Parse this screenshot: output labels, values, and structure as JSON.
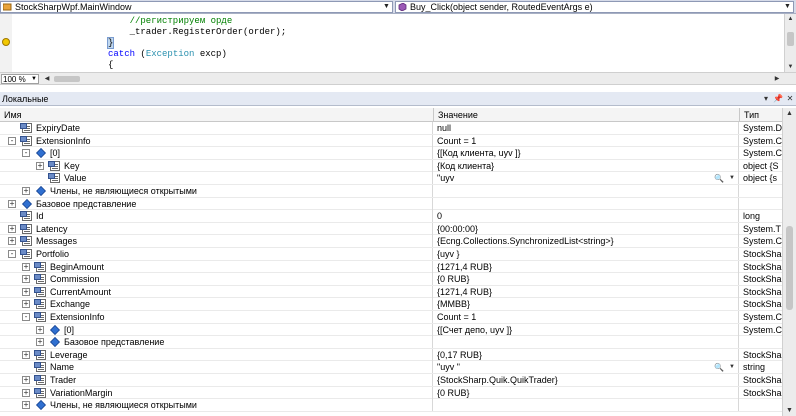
{
  "navbar": {
    "class_combo": "StockSharpWpf.MainWindow",
    "member_combo": "Buy_Click(object sender, RoutedEventArgs e)"
  },
  "editor": {
    "lines": [
      {
        "text": "    //регистрируем орде",
        "kind": "comment"
      },
      {
        "text": "    _trader.RegisterOrder(order);",
        "kind": "code"
      },
      {
        "text": "}",
        "kind": "brace"
      },
      {
        "text_kw": "catch",
        "text_open": " (",
        "text_type": "Exception",
        "text_rest": " excp)",
        "kind": "catch"
      },
      {
        "text": "{",
        "kind": "code"
      }
    ]
  },
  "zoom": {
    "value": "100 %"
  },
  "locals": {
    "title": "Локальные",
    "pin_icon": "pin-icon",
    "close_icon": "close-icon",
    "columns": {
      "name": "Имя",
      "value": "Значение",
      "type": "Тип"
    },
    "rows": [
      {
        "indent": 1,
        "expander": "",
        "icon": "prop",
        "name": "ExpiryDate",
        "value": "null",
        "type": "System.D"
      },
      {
        "indent": 1,
        "expander": "-",
        "icon": "prop",
        "name": "ExtensionInfo",
        "value": "Count = 1",
        "type": "System.C"
      },
      {
        "indent": 2,
        "expander": "-",
        "icon": "diamond",
        "name": "[0]",
        "value": "{[Код клиента, uyv        ]}",
        "type": "System.C"
      },
      {
        "indent": 3,
        "expander": "+",
        "icon": "prop",
        "name": "Key",
        "value": "{Код клиента}",
        "type": "object {S"
      },
      {
        "indent": 3,
        "expander": "",
        "icon": "prop",
        "name": "Value",
        "value": "\"uyv",
        "type": "object {s",
        "search": true
      },
      {
        "indent": 2,
        "expander": "+",
        "icon": "diamond",
        "name": "Члены, не являющиеся открытыми",
        "value": "",
        "type": ""
      },
      {
        "indent": 1,
        "expander": "+",
        "icon": "diamond",
        "name": "Базовое представление",
        "value": "",
        "type": ""
      },
      {
        "indent": 1,
        "expander": "",
        "icon": "prop",
        "name": "Id",
        "value": "0",
        "type": "long"
      },
      {
        "indent": 1,
        "expander": "+",
        "icon": "prop",
        "name": "Latency",
        "value": "{00:00:00}",
        "type": "System.T"
      },
      {
        "indent": 1,
        "expander": "+",
        "icon": "prop",
        "name": "Messages",
        "value": "{Ecng.Collections.SynchronizedList<string>}",
        "type": "System.C"
      },
      {
        "indent": 1,
        "expander": "-",
        "icon": "prop",
        "name": "Portfolio",
        "value": "{uyv        }",
        "type": "StockSha"
      },
      {
        "indent": 2,
        "expander": "+",
        "icon": "prop",
        "name": "BeginAmount",
        "value": "{1271,4 RUB}",
        "type": "StockSha"
      },
      {
        "indent": 2,
        "expander": "+",
        "icon": "prop",
        "name": "Commission",
        "value": "{0 RUB}",
        "type": "StockSha"
      },
      {
        "indent": 2,
        "expander": "+",
        "icon": "prop",
        "name": "CurrentAmount",
        "value": "{1271,4 RUB}",
        "type": "StockSha"
      },
      {
        "indent": 2,
        "expander": "+",
        "icon": "prop",
        "name": "Exchange",
        "value": "{MMBB}",
        "type": "StockSha"
      },
      {
        "indent": 2,
        "expander": "-",
        "icon": "prop",
        "name": "ExtensionInfo",
        "value": "Count = 1",
        "type": "System.C"
      },
      {
        "indent": 3,
        "expander": "+",
        "icon": "diamond",
        "name": "[0]",
        "value": "{[Счет депо, uyv        ]}",
        "type": "System.C"
      },
      {
        "indent": 3,
        "expander": "+",
        "icon": "diamond",
        "name": "Базовое представление",
        "value": "",
        "type": ""
      },
      {
        "indent": 2,
        "expander": "+",
        "icon": "prop",
        "name": "Leverage",
        "value": "{0,17 RUB}",
        "type": "StockSha"
      },
      {
        "indent": 2,
        "expander": "",
        "icon": "prop",
        "name": "Name",
        "value": "\"uyv       \"",
        "type": "string",
        "search": true
      },
      {
        "indent": 2,
        "expander": "+",
        "icon": "prop",
        "name": "Trader",
        "value": "{StockSharp.Quik.QuikTrader}",
        "type": "StockSha"
      },
      {
        "indent": 2,
        "expander": "+",
        "icon": "prop",
        "name": "VariationMargin",
        "value": "{0 RUB}",
        "type": "StockSha"
      },
      {
        "indent": 2,
        "expander": "+",
        "icon": "diamond",
        "name": "Члены, не являющиеся открытыми",
        "value": "",
        "type": ""
      }
    ]
  }
}
